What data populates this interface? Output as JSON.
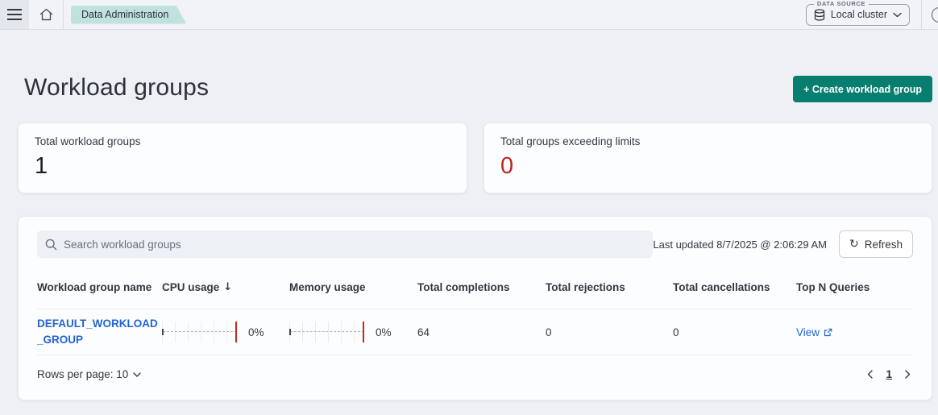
{
  "topbar": {
    "breadcrumb": "Data Administration",
    "data_source": {
      "label": "DATA SOURCE",
      "value": "Local cluster"
    }
  },
  "page": {
    "title": "Workload groups",
    "create_button": "+ Create workload group"
  },
  "stats": [
    {
      "label": "Total workload groups",
      "value": "1"
    },
    {
      "label": "Total groups exceeding limits",
      "value": "0"
    }
  ],
  "table_panel": {
    "search_placeholder": "Search workload groups",
    "last_updated": "Last updated 8/7/2025 @ 2:06:29 AM",
    "refresh_label": "Refresh",
    "refresh_glyph": "↻",
    "columns": [
      "Workload group name",
      "CPU usage",
      "Memory usage",
      "Total completions",
      "Total rejections",
      "Total cancellations",
      "Top N Queries"
    ],
    "sort": {
      "column": "CPU usage",
      "indicator": "↓"
    },
    "rows": [
      {
        "name": "DEFAULT_WORKLOAD_GROUP",
        "cpu_usage": "0%",
        "memory_usage": "0%",
        "total_completions": "64",
        "total_rejections": "0",
        "total_cancellations": "0",
        "top_n_queries": "View"
      }
    ],
    "rows_per_page_label": "Rows per page: 10",
    "pagination": {
      "current_page": "1"
    }
  },
  "colors": {
    "accent": "#077e70",
    "accent_text": "#ffffff",
    "danger": "#bd271e",
    "danger_line": "#c5281e",
    "link": "#2164d2",
    "tag_bg": "#bfe2de",
    "page_bg": "#eef0f4",
    "topbar_bg": "#f1f3f6",
    "panel_bg": "#fcfdfe",
    "border": "#d6dce5",
    "text": "#343741",
    "subtle_text": "#69707d"
  }
}
